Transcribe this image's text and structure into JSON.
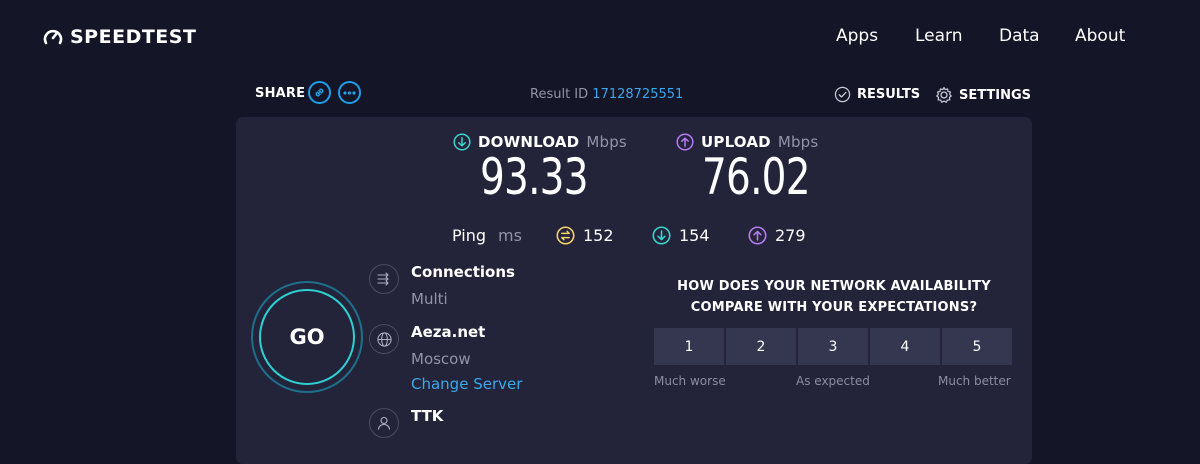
{
  "header": {
    "logo_text": "SPEEDTEST",
    "nav": [
      "Apps",
      "Learn",
      "Data",
      "About"
    ]
  },
  "share": {
    "label": "SHARE"
  },
  "result": {
    "label": "Result ID",
    "id": "17128725551"
  },
  "top_links": {
    "results": "RESULTS",
    "settings": "SETTINGS"
  },
  "download": {
    "label": "DOWNLOAD",
    "unit": "Mbps",
    "value": "93.33"
  },
  "upload": {
    "label": "UPLOAD",
    "unit": "Mbps",
    "value": "76.02"
  },
  "ping": {
    "label": "Ping",
    "unit": "ms",
    "idle": "152",
    "download": "154",
    "upload": "279"
  },
  "go": {
    "label": "GO"
  },
  "connections": {
    "title": "Connections",
    "value": "Multi"
  },
  "server": {
    "name": "Aeza.net",
    "location": "Moscow",
    "change_label": "Change Server"
  },
  "provider": {
    "name": "TTK"
  },
  "survey": {
    "question_line1": "HOW DOES YOUR NETWORK AVAILABILITY",
    "question_line2": "COMPARE WITH YOUR EXPECTATIONS?",
    "options": [
      "1",
      "2",
      "3",
      "4",
      "5"
    ],
    "scale_low": "Much worse",
    "scale_mid": "As expected",
    "scale_high": "Much better"
  },
  "colors": {
    "background": "#141526",
    "panel": "#232439",
    "accent_blue": "#1c9ee8",
    "download_teal": "#38d4cd",
    "upload_purple": "#b57cf2",
    "ping_yellow": "#f2d36b"
  }
}
